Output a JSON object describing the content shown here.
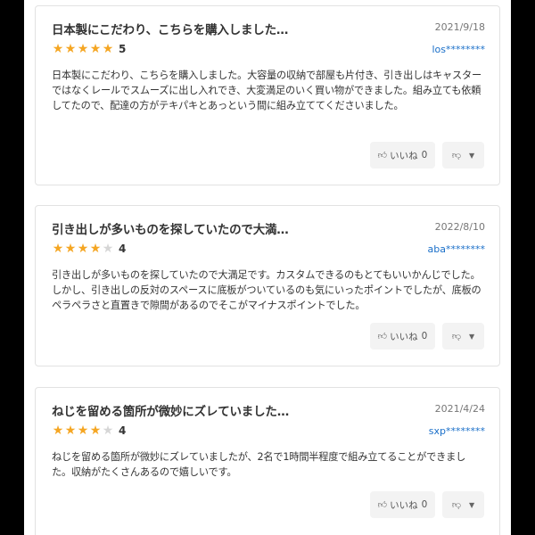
{
  "reviews": [
    {
      "title": "日本製にこだわり、こちらを購入しました…",
      "date": "2021/9/18",
      "rating": 5,
      "score_label": "5",
      "user": "los********",
      "body": "日本製にこだわり、こちらを購入しました。大容量の収納で部屋も片付き、引き出しはキャスターではなくレールでスムーズに出し入れでき、大変満足のいく買い物ができました。組み立ても依頼してたので、配達の方がテキパキとあっという間に組み立ててくださいました。",
      "like_label": "いいね",
      "like_count": "0"
    },
    {
      "title": "引き出しが多いものを探していたので大満…",
      "date": "2022/8/10",
      "rating": 4,
      "score_label": "4",
      "user": "aba********",
      "body": "引き出しが多いものを探していたので大満足です。カスタムできるのもとてもいいかんじでした。しかし、引き出しの反対のスペースに底板がついているのも気にいったポイントでしたが、底板のペラペラさと直置きで隙間があるのでそこがマイナスポイントでした。",
      "like_label": "いいね",
      "like_count": "0"
    },
    {
      "title": "ねじを留める箇所が微妙にズレていました…",
      "date": "2021/4/24",
      "rating": 4,
      "score_label": "4",
      "user": "sxp********",
      "body": "ねじを留める箇所が微妙にズレていましたが、2名で1時間半程度で組み立てることができました。収納がたくさんあるので嬉しいです。",
      "like_label": "いいね",
      "like_count": "0"
    }
  ],
  "colors": {
    "star_on": "#f5a623",
    "star_off": "#d6d6d6",
    "user_link": "#1a6fc9",
    "button_bg": "#f3f3f3"
  },
  "icons": {
    "like": "thumbs-up-icon",
    "dislike": "thumbs-down-icon",
    "chevron": "chevron-down-icon"
  }
}
